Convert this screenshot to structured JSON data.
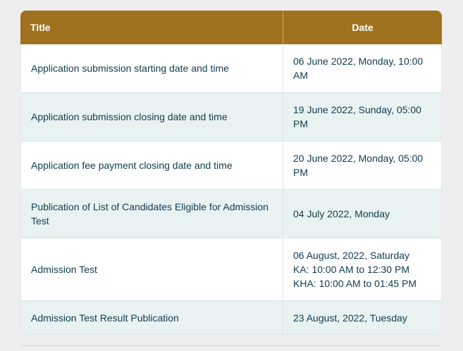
{
  "table": {
    "headers": {
      "title": "Title",
      "date": "Date"
    },
    "rows": [
      {
        "title": "Application submission starting date and time",
        "date": [
          "06 June 2022, Monday, 10:00",
          "AM"
        ]
      },
      {
        "title": "Application submission closing date and time",
        "date": [
          "19 June 2022, Sunday, 05:00",
          "PM"
        ]
      },
      {
        "title": "Application fee payment closing date and time",
        "date": [
          "20 June 2022, Monday, 05:00",
          "PM"
        ]
      },
      {
        "title": [
          "Publication of List of Candidates Eligible for Admission",
          "Test"
        ],
        "date": [
          "04 July 2022, Monday"
        ]
      },
      {
        "title": "Admission Test",
        "date": [
          "06 August, 2022, Saturday",
          "KA: 10:00 AM to 12:30 PM",
          "KHA: 10:00 AM to 01:45 PM"
        ]
      },
      {
        "title": "Admission Test Result Publication",
        "date": [
          "23 August, 2022, Tuesday"
        ]
      }
    ]
  },
  "colors": {
    "header_bg": "#a0721f",
    "header_text": "#ffffff",
    "body_text": "#0f3c4e",
    "stripe_bg": "#e9f2f2",
    "page_bg": "#eeeeee"
  }
}
